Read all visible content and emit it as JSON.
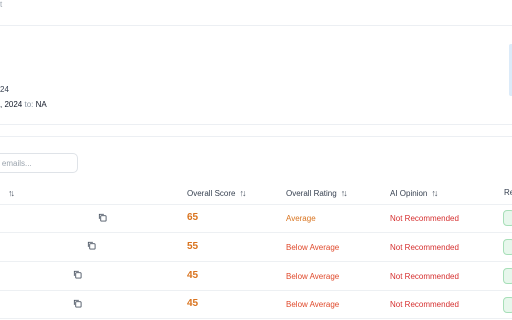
{
  "header": {
    "top_fragment": "t"
  },
  "meta": {
    "line1": "24",
    "line2_value": ", 2024",
    "line2_to_label": "to:",
    "line2_to_value": "NA"
  },
  "search": {
    "placeholder": "r emails..."
  },
  "table": {
    "columns": [
      {
        "label": "",
        "sortable": true
      },
      {
        "label": "Overall Score",
        "sortable": true
      },
      {
        "label": "Overall Rating",
        "sortable": true
      },
      {
        "label": "AI Opinion",
        "sortable": true
      },
      {
        "label": "Re",
        "sortable": false
      }
    ],
    "rows": [
      {
        "score": "65",
        "rating": "Average",
        "opinion": "Not Recommended"
      },
      {
        "score": "55",
        "rating": "Below Average",
        "opinion": "Not Recommended"
      },
      {
        "score": "45",
        "rating": "Below Average",
        "opinion": "Not Recommended"
      },
      {
        "score": "45",
        "rating": "Below Average",
        "opinion": "Not Recommended"
      }
    ]
  },
  "icons": {
    "sort": "sort-arrows-icon",
    "copy": "copy-icon"
  },
  "colors": {
    "score_orange": "#d9731e",
    "rating_average": "#d9731e",
    "rating_below": "#e0492b",
    "opinion_red": "#d62f2f",
    "chip_green": "#e7f7ec"
  }
}
